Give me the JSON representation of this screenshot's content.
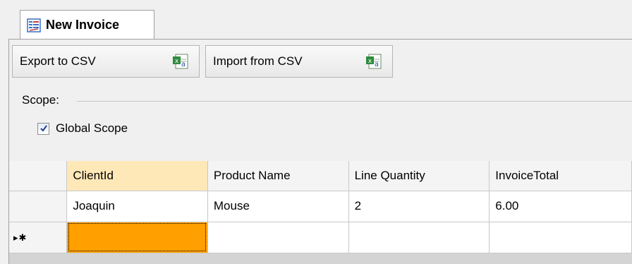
{
  "tab": {
    "label": "New Invoice",
    "icon": "form-icon"
  },
  "toolbar": {
    "export_label": "Export to CSV",
    "import_label": "Import from CSV",
    "csv_icon": "excel-icon"
  },
  "scope": {
    "group_label": "Scope:",
    "global_label": "Global Scope",
    "global_checked": true
  },
  "grid": {
    "columns": [
      "ClientId",
      "Product Name",
      "Line Quantity",
      "InvoiceTotal"
    ],
    "rows": [
      [
        "Joaquin",
        "Mouse",
        "2",
        "6.00"
      ]
    ],
    "new_row_marker": "▸✱",
    "selected_color": "#ffa000"
  }
}
